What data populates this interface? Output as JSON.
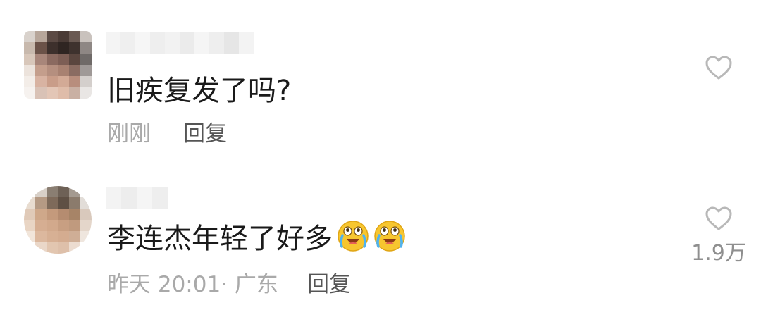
{
  "comments": [
    {
      "text": "旧疾复发了吗?",
      "time": "刚刚",
      "reply_label": "回复",
      "icons": {
        "like": "heart-outline-icon"
      }
    },
    {
      "text": "李连杰年轻了好多",
      "time": "昨天 20:01·",
      "location": "广东",
      "reply_label": "回复",
      "like_count": "1.9万",
      "icons": {
        "like": "heart-outline-icon",
        "emoji": "crying-laughing-emoji-icon"
      }
    }
  ],
  "colors": {
    "text": "#1a1a1a",
    "meta": "#a9a9a9",
    "reply": "#555555",
    "icon": "#b8b8b8",
    "background": "#ffffff"
  }
}
